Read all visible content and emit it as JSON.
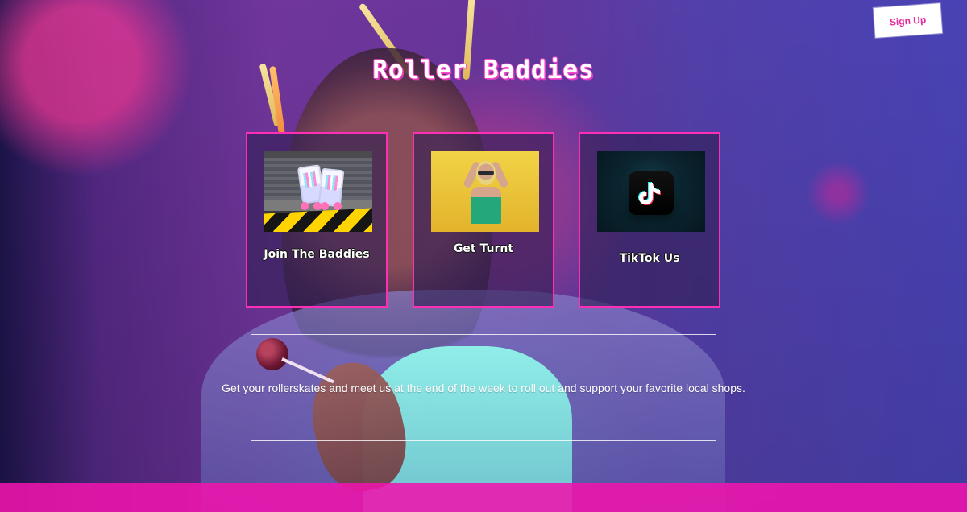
{
  "header": {
    "signup_label": "Sign Up"
  },
  "hero": {
    "title": "Roller Baddies"
  },
  "cards": [
    {
      "label": "Join The Baddies",
      "icon": "roller-skates-image"
    },
    {
      "label": "Get Turnt",
      "icon": "party-person-image"
    },
    {
      "label": "TikTok Us",
      "icon": "tiktok-app-icon"
    }
  ],
  "content": {
    "message": "Get your rollerskates and meet us at the end of the week to roll out and support your favorite local shops."
  },
  "colors": {
    "accent_pink": "#ff2fb5",
    "footer_pink": "#ef15ad"
  }
}
